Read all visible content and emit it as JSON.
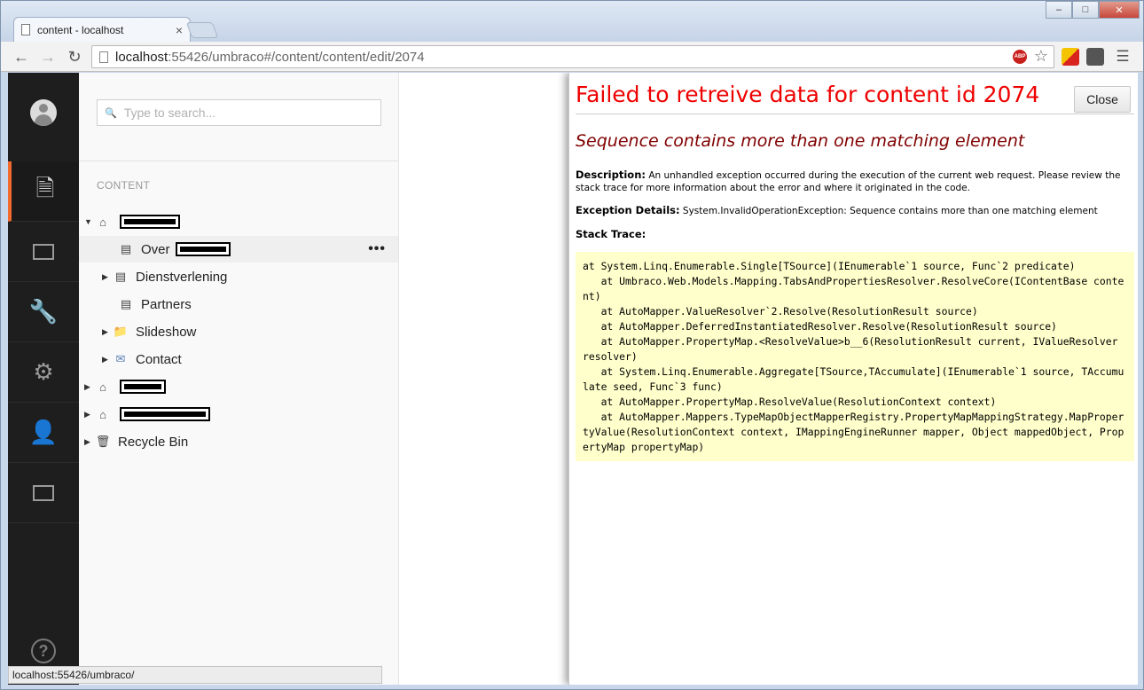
{
  "browser": {
    "tab_title": "content - localhost",
    "url_host": "localhost",
    "url_path": ":55426/umbraco#/content/content/edit/2074",
    "status_url": "localhost:55426/umbraco/",
    "window_buttons": [
      "–",
      "□",
      "✕"
    ],
    "abp_label": "ABP"
  },
  "sidebar": {
    "sections": [
      {
        "name": "content",
        "icon": "document-icon",
        "active": true
      },
      {
        "name": "media",
        "icon": "image-icon",
        "active": false
      },
      {
        "name": "developer",
        "icon": "wrench-icon",
        "active": false
      },
      {
        "name": "settings",
        "icon": "gear-icon",
        "active": false
      },
      {
        "name": "users",
        "icon": "user-icon",
        "active": false
      },
      {
        "name": "members",
        "icon": "id-card-icon",
        "active": false
      }
    ],
    "help": "?"
  },
  "tree": {
    "search_placeholder": "Type to search...",
    "heading": "CONTENT",
    "items": [
      {
        "label": "Over"
      },
      {
        "label": "Dienstverlening"
      },
      {
        "label": "Partners"
      },
      {
        "label": "Slideshow"
      },
      {
        "label": "Contact"
      },
      {
        "label": "Recycle Bin"
      }
    ],
    "more": "•••"
  },
  "error": {
    "title": "Failed to retreive data for content id 2074",
    "close_label": "Close",
    "subtitle": "Sequence contains more than one matching element",
    "description_label": "Description:",
    "description_text": " An unhandled exception occurred during the execution of the current web request. Please review the stack trace for more information about the error and where it originated in the code.",
    "exception_label": "Exception Details:",
    "exception_text": " System.InvalidOperationException: Sequence contains more than one matching element",
    "stack_label": "Stack Trace:",
    "stack_trace": "at System.Linq.Enumerable.Single[TSource](IEnumerable`1 source, Func`2 predicate)\n   at Umbraco.Web.Models.Mapping.TabsAndPropertiesResolver.ResolveCore(IContentBase content)\n   at AutoMapper.ValueResolver`2.Resolve(ResolutionResult source)\n   at AutoMapper.DeferredInstantiatedResolver.Resolve(ResolutionResult source)\n   at AutoMapper.PropertyMap.<ResolveValue>b__6(ResolutionResult current, IValueResolver resolver)\n   at System.Linq.Enumerable.Aggregate[TSource,TAccumulate](IEnumerable`1 source, TAccumulate seed, Func`3 func)\n   at AutoMapper.PropertyMap.ResolveValue(ResolutionContext context)\n   at AutoMapper.Mappers.TypeMapObjectMapperRegistry.PropertyMapMappingStrategy.MapPropertyValue(ResolutionContext context, IMappingEngineRunner mapper, Object mappedObject, PropertyMap propertyMap)"
  }
}
